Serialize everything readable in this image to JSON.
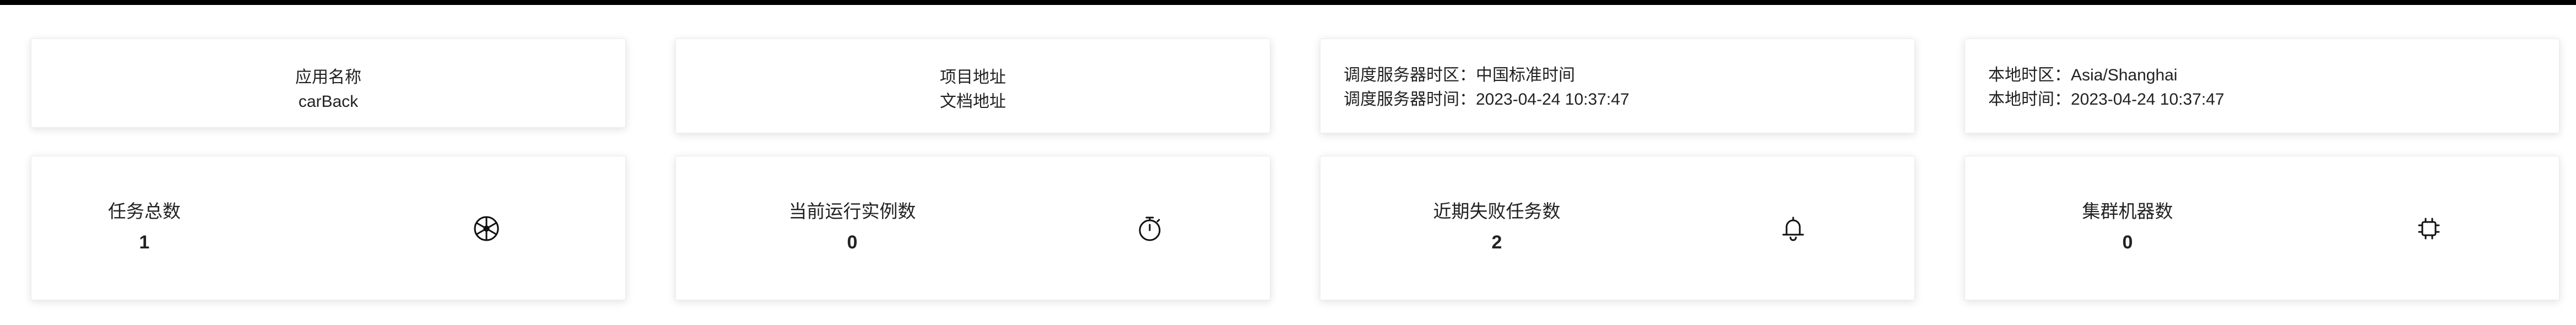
{
  "info_cards": {
    "app": {
      "label": "应用名称",
      "value": "carBack"
    },
    "project": {
      "project_link": "项目地址",
      "docs_link": "文档地址"
    },
    "scheduler": {
      "timezone": "调度服务器时区：中国标准时间",
      "time": "调度服务器时间：2023-04-24 10:37:47"
    },
    "local": {
      "timezone": "本地时区：Asia/Shanghai",
      "time": "本地时间：2023-04-24 10:37:47"
    }
  },
  "stats": [
    {
      "label": "任务总数",
      "value": "1",
      "icon": "wheel-icon"
    },
    {
      "label": "当前运行实例数",
      "value": "0",
      "icon": "stopwatch-icon"
    },
    {
      "label": "近期失败任务数",
      "value": "2",
      "icon": "bell-icon"
    },
    {
      "label": "集群机器数",
      "value": "0",
      "icon": "chip-icon"
    }
  ]
}
